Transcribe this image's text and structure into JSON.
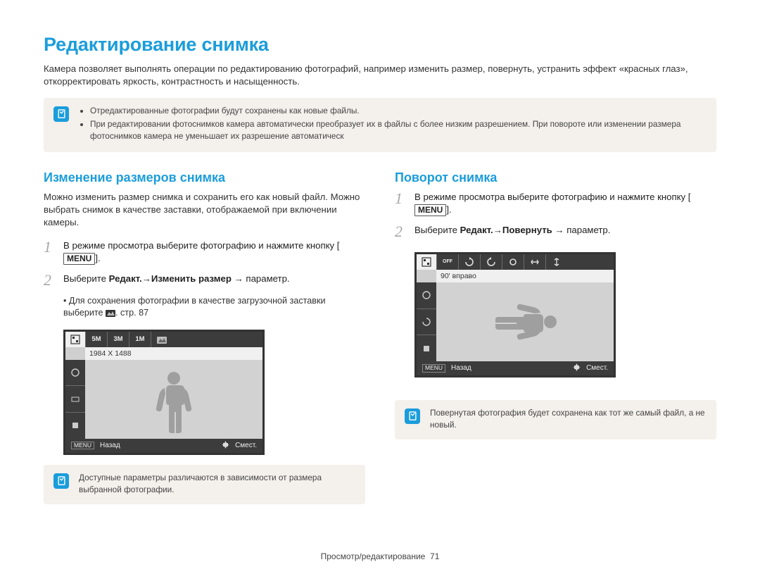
{
  "page_title": "Редактирование снимка",
  "intro": "Камера позволяет выполнять операции по редактированию фотографий, например изменить размер, повернуть, устранить эффект «красных глаз», откорректировать яркость, контрастность и насыщенность.",
  "top_note": {
    "bullets": [
      "Отредактированные фотографии будут сохранены как новые файлы.",
      "При редактировании фотоснимков камера автоматически преобразует их в файлы с более низким разрешением. При повороте или изменении размера фотоснимков камера не уменьшает их разрешение автоматическ"
    ]
  },
  "left": {
    "heading": "Изменение размеров снимка",
    "body": "Можно изменить размер снимка и сохранить его как новый файл. Можно выбрать снимок в качестве заставки, отображаемой при включении камеры.",
    "step1_a": "В режиме просмотра выберите фотографию и нажмите кнопку [",
    "step1_menu": "MENU",
    "step1_b": "].",
    "step2_a": "Выберите ",
    "step2_b": "Редакт.",
    "step2_c": " → ",
    "step2_d": "Изменить размер",
    "step2_e": " → параметр.",
    "substep_a": "Для сохранения фотографии в качестве загрузочной заставки выберите ",
    "substep_b": ". cтр. 87",
    "screen": {
      "top_resolutions": [
        "5M",
        "3M",
        "1M"
      ],
      "label_strip": "1984 X 1488",
      "bottom_left_btn": "MENU",
      "bottom_left": "Назад",
      "bottom_right": "Смест."
    },
    "note": "Доступные параметры различаются в зависимости от размера выбранной фотографии."
  },
  "right": {
    "heading": "Поворот снимка",
    "step1_a": "В режиме просмотра выберите фотографию и нажмите кнопку [",
    "step1_menu": "MENU",
    "step1_b": "].",
    "step2_a": "Выберите ",
    "step2_b": "Редакт.",
    "step2_c": " → ",
    "step2_d": "Повернуть",
    "step2_e": " → параметр.",
    "screen": {
      "label_strip": "90' вправо",
      "bottom_left_btn": "MENU",
      "bottom_left": "Назад",
      "bottom_right": "Смест."
    },
    "note": "Повернутая фотография будет сохранена как тот же самый файл, а не новый."
  },
  "footer_section": "Просмотр/редактирование",
  "footer_page": "71"
}
